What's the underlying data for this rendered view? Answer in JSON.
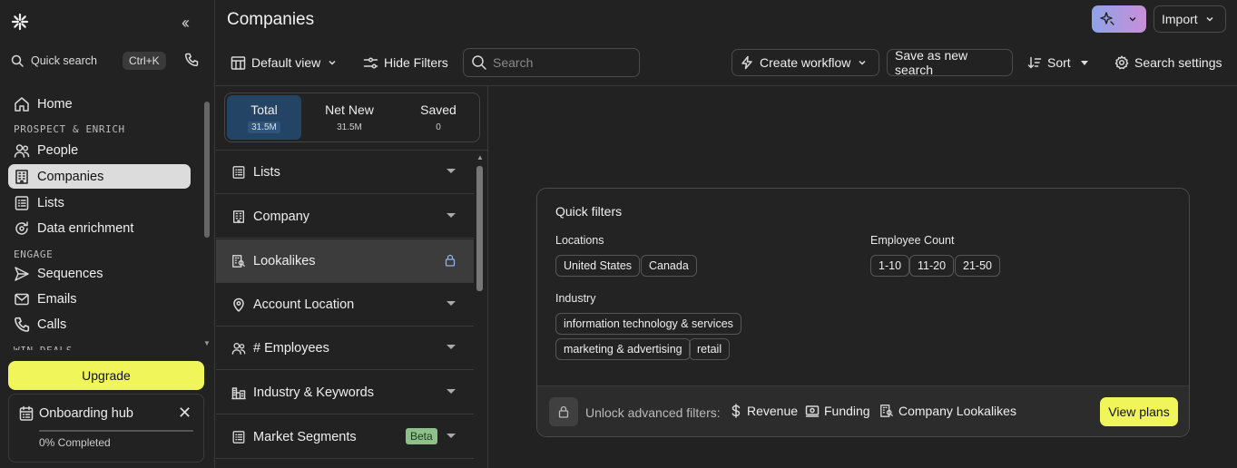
{
  "nav": {
    "quick_search": "Quick search",
    "shortcut": "Ctrl+K",
    "items": [
      {
        "label": "Home"
      },
      {
        "label": "People"
      },
      {
        "label": "Companies"
      },
      {
        "label": "Lists"
      },
      {
        "label": "Data enrichment"
      },
      {
        "label": "Sequences"
      },
      {
        "label": "Emails"
      },
      {
        "label": "Calls"
      }
    ],
    "sections": {
      "prospect": "PROSPECT & ENRICH",
      "engage": "ENGAGE",
      "win": "WIN DEALS"
    },
    "upgrade": "Upgrade",
    "onboarding": {
      "title": "Onboarding hub",
      "progress_text": "0% Completed",
      "progress": 0
    }
  },
  "header": {
    "title": "Companies",
    "import": "Import"
  },
  "toolbar": {
    "default_view": "Default view",
    "hide_filters": "Hide Filters",
    "search_placeholder": "Search",
    "create_workflow": "Create workflow",
    "save_search": "Save as new search",
    "sort": "Sort",
    "search_settings": "Search settings"
  },
  "tabs": [
    {
      "label": "Total",
      "count": "31.5M"
    },
    {
      "label": "Net New",
      "count": "31.5M"
    },
    {
      "label": "Saved",
      "count": "0"
    }
  ],
  "filters": [
    {
      "label": "Lists"
    },
    {
      "label": "Company"
    },
    {
      "label": "Lookalikes"
    },
    {
      "label": "Account Location"
    },
    {
      "label": "# Employees"
    },
    {
      "label": "Industry & Keywords"
    },
    {
      "label": "Market Segments",
      "badge": "Beta"
    }
  ],
  "quick_filters": {
    "title": "Quick filters",
    "locations_label": "Locations",
    "locations": [
      "United States",
      "Canada"
    ],
    "employee_label": "Employee Count",
    "employee": [
      "1-10",
      "11-20",
      "21-50"
    ],
    "industry_label": "Industry",
    "industry": [
      "information technology & services",
      "marketing & advertising",
      "retail"
    ],
    "unlock_text": "Unlock advanced filters:",
    "advanced": [
      "Revenue",
      "Funding",
      "Company Lookalikes"
    ],
    "view_plans": "View plans"
  },
  "colors": {
    "accent": "#f0f55a",
    "active_tab": "#244466",
    "ai_gradient": "#8fa3e8",
    "beta": "#8fbf8a"
  }
}
